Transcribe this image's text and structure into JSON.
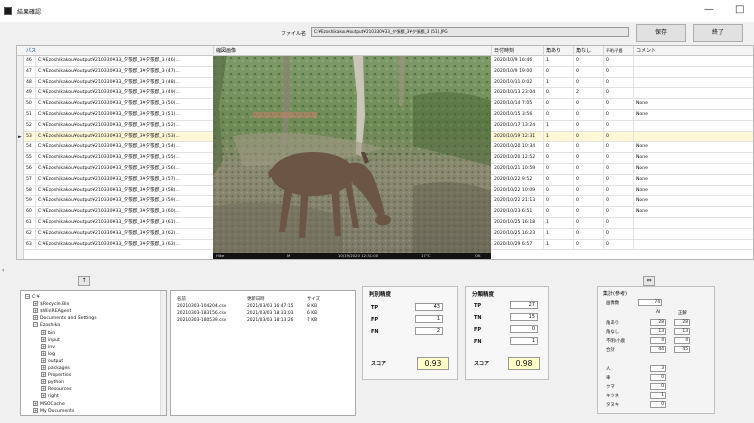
{
  "window": {
    "title": "結果確認",
    "minimize": "—",
    "maximize": "□"
  },
  "toolbar": {
    "file_label": "ファイル名",
    "file_value": "C:¥Ezoshikakou¥output¥210330¥33_夕張郡_3¥夕張郡_3 (51).JPG",
    "save_label": "保存",
    "exit_label": "終了"
  },
  "grid": {
    "columns": [
      "パス",
      "縮図画像",
      "日付時刻",
      "角あり",
      "角なし",
      "不明/子鹿",
      "コメント"
    ],
    "selected_index": 7,
    "rows": [
      {
        "num": "46",
        "path": "C:¥Ezoshikakou¥output¥210330¥33_夕張郡_3¥夕張郡_3 (46)...",
        "date": "2020/10/9 16:46",
        "a": "1",
        "b": "0",
        "c": "0",
        "comment": ""
      },
      {
        "num": "47",
        "path": "C:¥Ezoshikakou¥output¥210330¥33_夕張郡_3¥夕張郡_3 (47)...",
        "date": "2020/10/9 19:00",
        "a": "0",
        "b": "0",
        "c": "0",
        "comment": ""
      },
      {
        "num": "48",
        "path": "C:¥Ezoshikakou¥output¥210330¥33_夕張郡_3¥夕張郡_3 (48)...",
        "date": "2020/10/11 0:02",
        "a": "1",
        "b": "0",
        "c": "0",
        "comment": ""
      },
      {
        "num": "49",
        "path": "C:¥Ezoshikakou¥output¥210330¥33_夕張郡_3¥夕張郡_3 (49)...",
        "date": "2020/10/13 23:04",
        "a": "0",
        "b": "2",
        "c": "0",
        "comment": ""
      },
      {
        "num": "50",
        "path": "C:¥Ezoshikakou¥output¥210330¥33_夕張郡_3¥夕張郡_3 (50)...",
        "date": "2020/10/14 7:05",
        "a": "0",
        "b": "0",
        "c": "0",
        "comment": "None"
      },
      {
        "num": "51",
        "path": "C:¥Ezoshikakou¥output¥210330¥33_夕張郡_3¥夕張郡_3 (51)...",
        "date": "2020/10/15 3:56",
        "a": "0",
        "b": "0",
        "c": "0",
        "comment": "None"
      },
      {
        "num": "52",
        "path": "C:¥Ezoshikakou¥output¥210330¥33_夕張郡_3¥夕張郡_3 (52)...",
        "date": "2020/10/17 13:24",
        "a": "1",
        "b": "0",
        "c": "0",
        "comment": ""
      },
      {
        "num": "53",
        "path": "C:¥Ezoshikakou¥output¥210330¥33_夕張郡_3¥夕張郡_3 (53)...",
        "date": "2020/10/19 12:31",
        "a": "1",
        "b": "0",
        "c": "0",
        "comment": ""
      },
      {
        "num": "54",
        "path": "C:¥Ezoshikakou¥output¥210330¥33_夕張郡_3¥夕張郡_3 (54)...",
        "date": "2020/10/20 10:34",
        "a": "0",
        "b": "0",
        "c": "0",
        "comment": "None"
      },
      {
        "num": "55",
        "path": "C:¥Ezoshikakou¥output¥210330¥33_夕張郡_3¥夕張郡_3 (55)...",
        "date": "2020/10/20 12:52",
        "a": "0",
        "b": "0",
        "c": "0",
        "comment": "None"
      },
      {
        "num": "56",
        "path": "C:¥Ezoshikakou¥output¥210330¥33_夕張郡_3¥夕張郡_3 (56)...",
        "date": "2020/10/21 10:59",
        "a": "0",
        "b": "0",
        "c": "0",
        "comment": "None"
      },
      {
        "num": "57",
        "path": "C:¥Ezoshikakou¥output¥210330¥33_夕張郡_3¥夕張郡_3 (57)...",
        "date": "2020/10/22 9:52",
        "a": "0",
        "b": "0",
        "c": "0",
        "comment": "None"
      },
      {
        "num": "58",
        "path": "C:¥Ezoshikakou¥output¥210330¥33_夕張郡_3¥夕張郡_3 (58)...",
        "date": "2020/10/22 10:09",
        "a": "0",
        "b": "0",
        "c": "0",
        "comment": "None"
      },
      {
        "num": "59",
        "path": "C:¥Ezoshikakou¥output¥210330¥33_夕張郡_3¥夕張郡_3 (59)...",
        "date": "2020/10/22 21:13",
        "a": "0",
        "b": "0",
        "c": "0",
        "comment": "None"
      },
      {
        "num": "60",
        "path": "C:¥Ezoshikakou¥output¥210330¥33_夕張郡_3¥夕張郡_3 (60)...",
        "date": "2020/10/23 6:51",
        "a": "0",
        "b": "0",
        "c": "0",
        "comment": "None"
      },
      {
        "num": "61",
        "path": "C:¥Ezoshikakou¥output¥210330¥33_夕張郡_3¥夕張郡_3 (61)...",
        "date": "2020/10/25 16:18",
        "a": "1",
        "b": "0",
        "c": "0",
        "comment": ""
      },
      {
        "num": "62",
        "path": "C:¥Ezoshikakou¥output¥210330¥33_夕張郡_3¥夕張郡_3 (62)...",
        "date": "2020/10/25 16:23",
        "a": "1",
        "b": "0",
        "c": "0",
        "comment": ""
      },
      {
        "num": "63",
        "path": "C:¥Ezoshikakou¥output¥210330¥33_夕張郡_3¥夕張郡_3 (63)...",
        "date": "2020/10/29 6:57",
        "a": "1",
        "b": "0",
        "c": "0",
        "comment": ""
      }
    ]
  },
  "photo": {
    "caption_left": "Hike",
    "caption_mid": "M",
    "caption_date": "10/19/2020 12:31:00",
    "caption_temp": "17°C",
    "caption_right": "OK"
  },
  "splitters": {
    "left": "↑",
    "right": "⇔"
  },
  "tree": {
    "items": [
      {
        "label": "C:¥",
        "level": 0,
        "exp": "−"
      },
      {
        "label": "$Recycle.Bin",
        "level": 1,
        "exp": "+"
      },
      {
        "label": "$WinREAgent",
        "level": 1,
        "exp": "+"
      },
      {
        "label": "Documents and Settings",
        "level": 1,
        "exp": "+"
      },
      {
        "label": "Ezoshika",
        "level": 1,
        "exp": "−"
      },
      {
        "label": "bin",
        "level": 2,
        "exp": "+"
      },
      {
        "label": "input",
        "level": 2,
        "exp": "+"
      },
      {
        "label": "inv",
        "level": 2,
        "exp": "+"
      },
      {
        "label": "log",
        "level": 2,
        "exp": "+"
      },
      {
        "label": "output",
        "level": 2,
        "exp": "+"
      },
      {
        "label": "packages",
        "level": 2,
        "exp": "+"
      },
      {
        "label": "Properties",
        "level": 2,
        "exp": "+"
      },
      {
        "label": "python",
        "level": 2,
        "exp": "+"
      },
      {
        "label": "Resources",
        "level": 2,
        "exp": "+"
      },
      {
        "label": "right",
        "level": 2,
        "exp": "+"
      },
      {
        "label": "MSOCache",
        "level": 1,
        "exp": "+"
      },
      {
        "label": "My Documents",
        "level": 1,
        "exp": "+"
      }
    ]
  },
  "files": {
    "headers": [
      "名前",
      "更新日時",
      "サイズ"
    ],
    "rows": [
      {
        "name": "20210303-104204.csv",
        "date": "2021/03/03 16:47:15",
        "size": "8 KB"
      },
      {
        "name": "20210303-183156.csv",
        "date": "2021/03/03 18:33:03",
        "size": "6 KB"
      },
      {
        "name": "20210303-180539.csv",
        "date": "2021/03/03 18:13:26",
        "size": "7 KB"
      }
    ]
  },
  "metrics_a": {
    "title": "判別精度",
    "tp_label": "TP",
    "tp": "43",
    "fp_label": "FP",
    "fp": "1",
    "fn_label": "FN",
    "fn": "2",
    "score_label": "スコア",
    "score": "0.93"
  },
  "metrics_b": {
    "title": "分類精度",
    "tp_label": "TP",
    "tp": "27",
    "tn_label": "TN",
    "tn": "15",
    "fp_label": "FP",
    "fp": "0",
    "fn_label": "FN",
    "fn": "1",
    "score_label": "スコア",
    "score": "0.98"
  },
  "aggregate": {
    "title": "集計(参考)",
    "base_label": "画像数",
    "base_value": "74",
    "col_ai": "AI",
    "col_correct": "正解",
    "rows": [
      {
        "label": "角あり",
        "ai": "28",
        "correct": "28"
      },
      {
        "label": "角なし",
        "ai": "13",
        "correct": "13"
      },
      {
        "label": "不明/小鹿",
        "ai": "4",
        "correct": "4"
      },
      {
        "label": "合計",
        "ai": "44",
        "correct": "45"
      }
    ],
    "others": [
      {
        "label": "人",
        "value": "3"
      },
      {
        "label": "車",
        "value": "0"
      },
      {
        "label": "クマ",
        "value": "0"
      },
      {
        "label": "キツネ",
        "value": "1"
      },
      {
        "label": "タヌキ",
        "value": "0"
      }
    ]
  }
}
